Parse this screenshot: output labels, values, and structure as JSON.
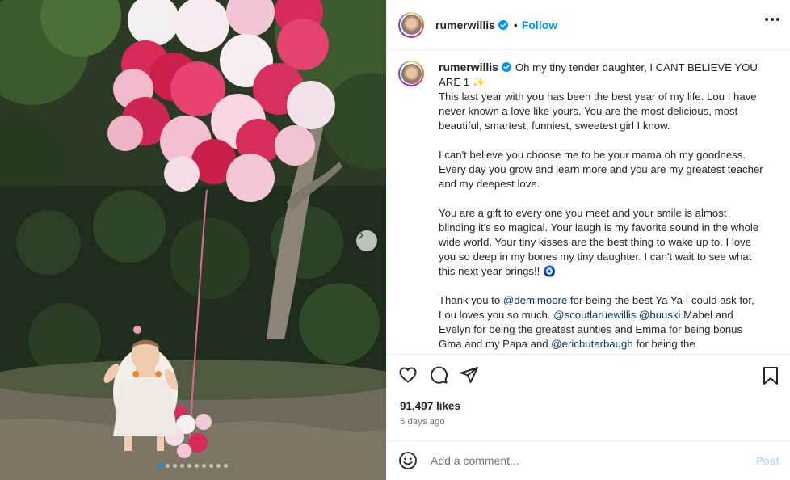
{
  "post": {
    "username": "rumerwillis",
    "separator": "•",
    "follow_label": "Follow",
    "more_icon": "more-horizontal-icon",
    "likes": "91,497 likes",
    "posted": "5 days ago",
    "carousel": {
      "total": 10,
      "current": 1
    }
  },
  "caption": {
    "line1": "Oh my tiny tender daughter, I CANT BELIEVE YOU ARE 1",
    "sparkle": "✨",
    "p1": "This last year with you has been the best year of my life. Lou I have never known a love like yours. You are the most delicious, most beautiful, smartest, funniest, sweetest girl I know.",
    "p2": "I can't believe you choose me to be your mama oh my goodness. Every day you grow and learn more and you are my greatest teacher and my deepest love.",
    "p3": "You are a gift to every one you meet and your smile is almost blinding it's so magical. Your laugh is my favorite sound in the whole wide world. Your tiny kisses are the best thing to wake up to. I love you so deep in my bones my tiny daughter. I can't wait to see what this next year brings!!",
    "heart": "🧿",
    "p4_a": "Thank you to",
    "mention1": "@demimoore",
    "p4_b": "for being the best Ya Ya I could ask for, Lou loves you so much.",
    "mention2": "@scoutlaruewillis",
    "mention3": "@buuski",
    "p4_c": "Mabel and Evelyn for being the greatest aunties and Emma for being bonus Gma and my Papa and",
    "mention4": "@ericbuterbaugh",
    "p4_d": "for being the"
  },
  "comment": {
    "placeholder": "Add a comment...",
    "post_label": "Post"
  },
  "colors": {
    "link": "#0095f6",
    "mention": "#00376b",
    "post_disabled": "#b2dffc"
  }
}
